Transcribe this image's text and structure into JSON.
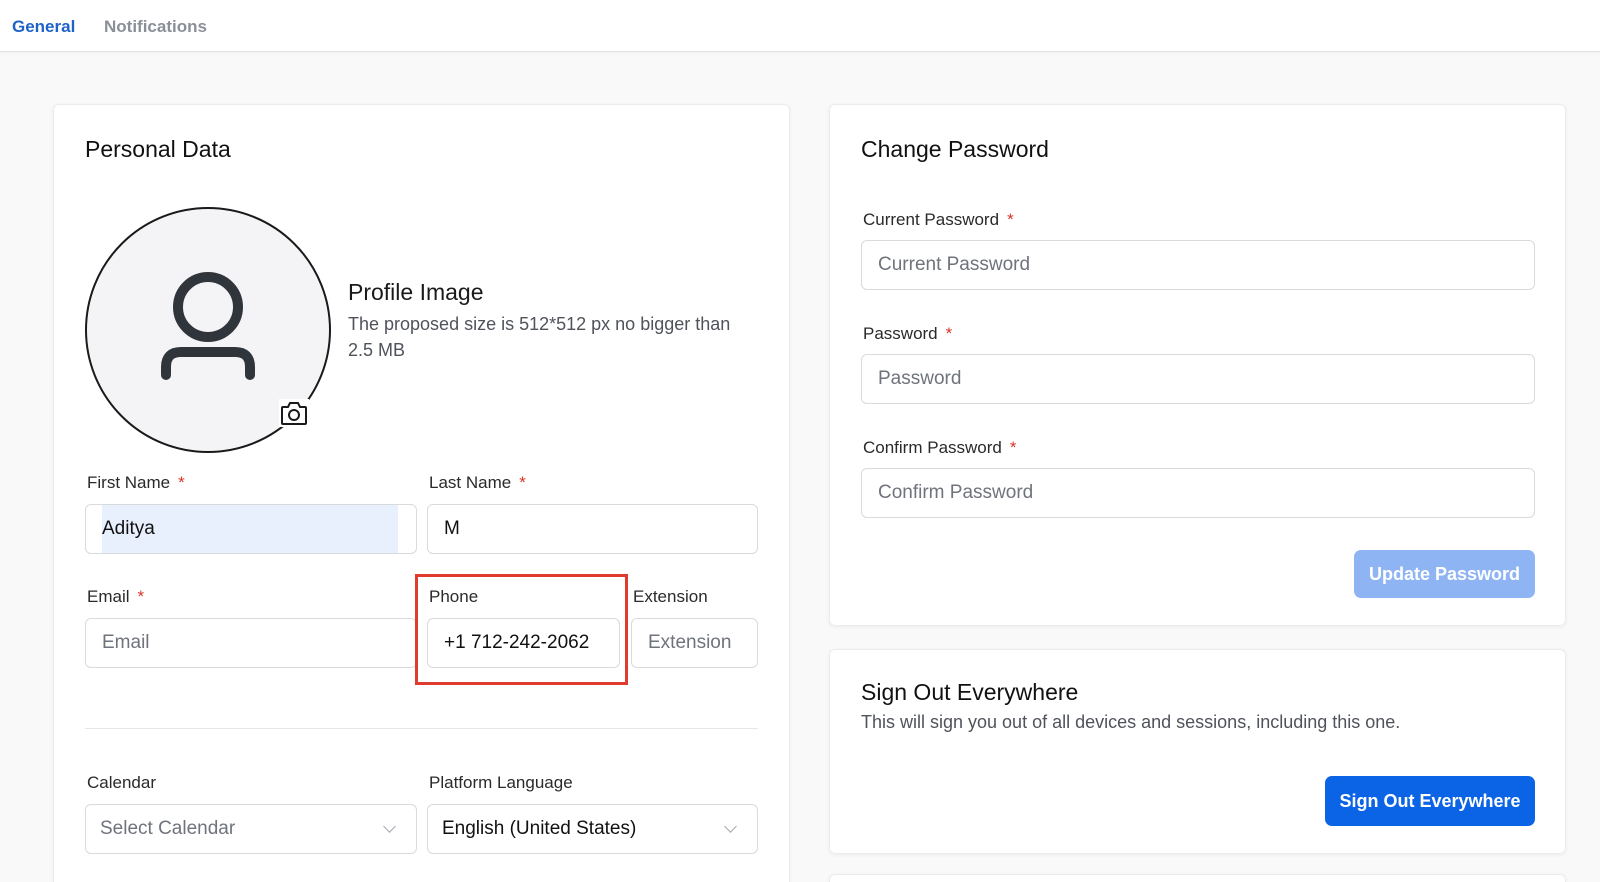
{
  "tabs": {
    "general": "General",
    "notifications": "Notifications"
  },
  "personal": {
    "title": "Personal Data",
    "profile_image": {
      "title": "Profile Image",
      "description": "The proposed size is 512*512 px no bigger than 2.5 MB"
    },
    "first_name": {
      "label": "First Name",
      "value": "Aditya",
      "required": "*"
    },
    "last_name": {
      "label": "Last Name",
      "value": "M",
      "required": "*"
    },
    "email": {
      "label": "Email",
      "placeholder": "Email",
      "value": "",
      "required": "*"
    },
    "phone": {
      "label": "Phone",
      "value": "+1 712-242-2062"
    },
    "extension": {
      "label": "Extension",
      "placeholder": "Extension",
      "value": ""
    },
    "calendar": {
      "label": "Calendar",
      "value": "Select Calendar"
    },
    "language": {
      "label": "Platform Language",
      "value": "English (United States)"
    }
  },
  "password": {
    "title": "Change Password",
    "current": {
      "label": "Current Password",
      "placeholder": "Current Password",
      "required": "*"
    },
    "new": {
      "label": "Password",
      "placeholder": "Password",
      "required": "*"
    },
    "confirm": {
      "label": "Confirm Password",
      "placeholder": "Confirm Password",
      "required": "*"
    },
    "update_button": "Update Password"
  },
  "signout": {
    "title": "Sign Out Everywhere",
    "description": "This will sign you out of all devices and sessions, including this one.",
    "button": "Sign Out Everywhere"
  },
  "icons": {
    "avatar": "user-icon",
    "camera": "camera-icon",
    "dropdown": "chevron-down-icon"
  },
  "colors": {
    "accent": "#1f63c9",
    "primary_button": "#0b63e5",
    "disabled_button": "#8fb4f3",
    "required": "#d9342b",
    "highlight": "#e03b2f"
  }
}
